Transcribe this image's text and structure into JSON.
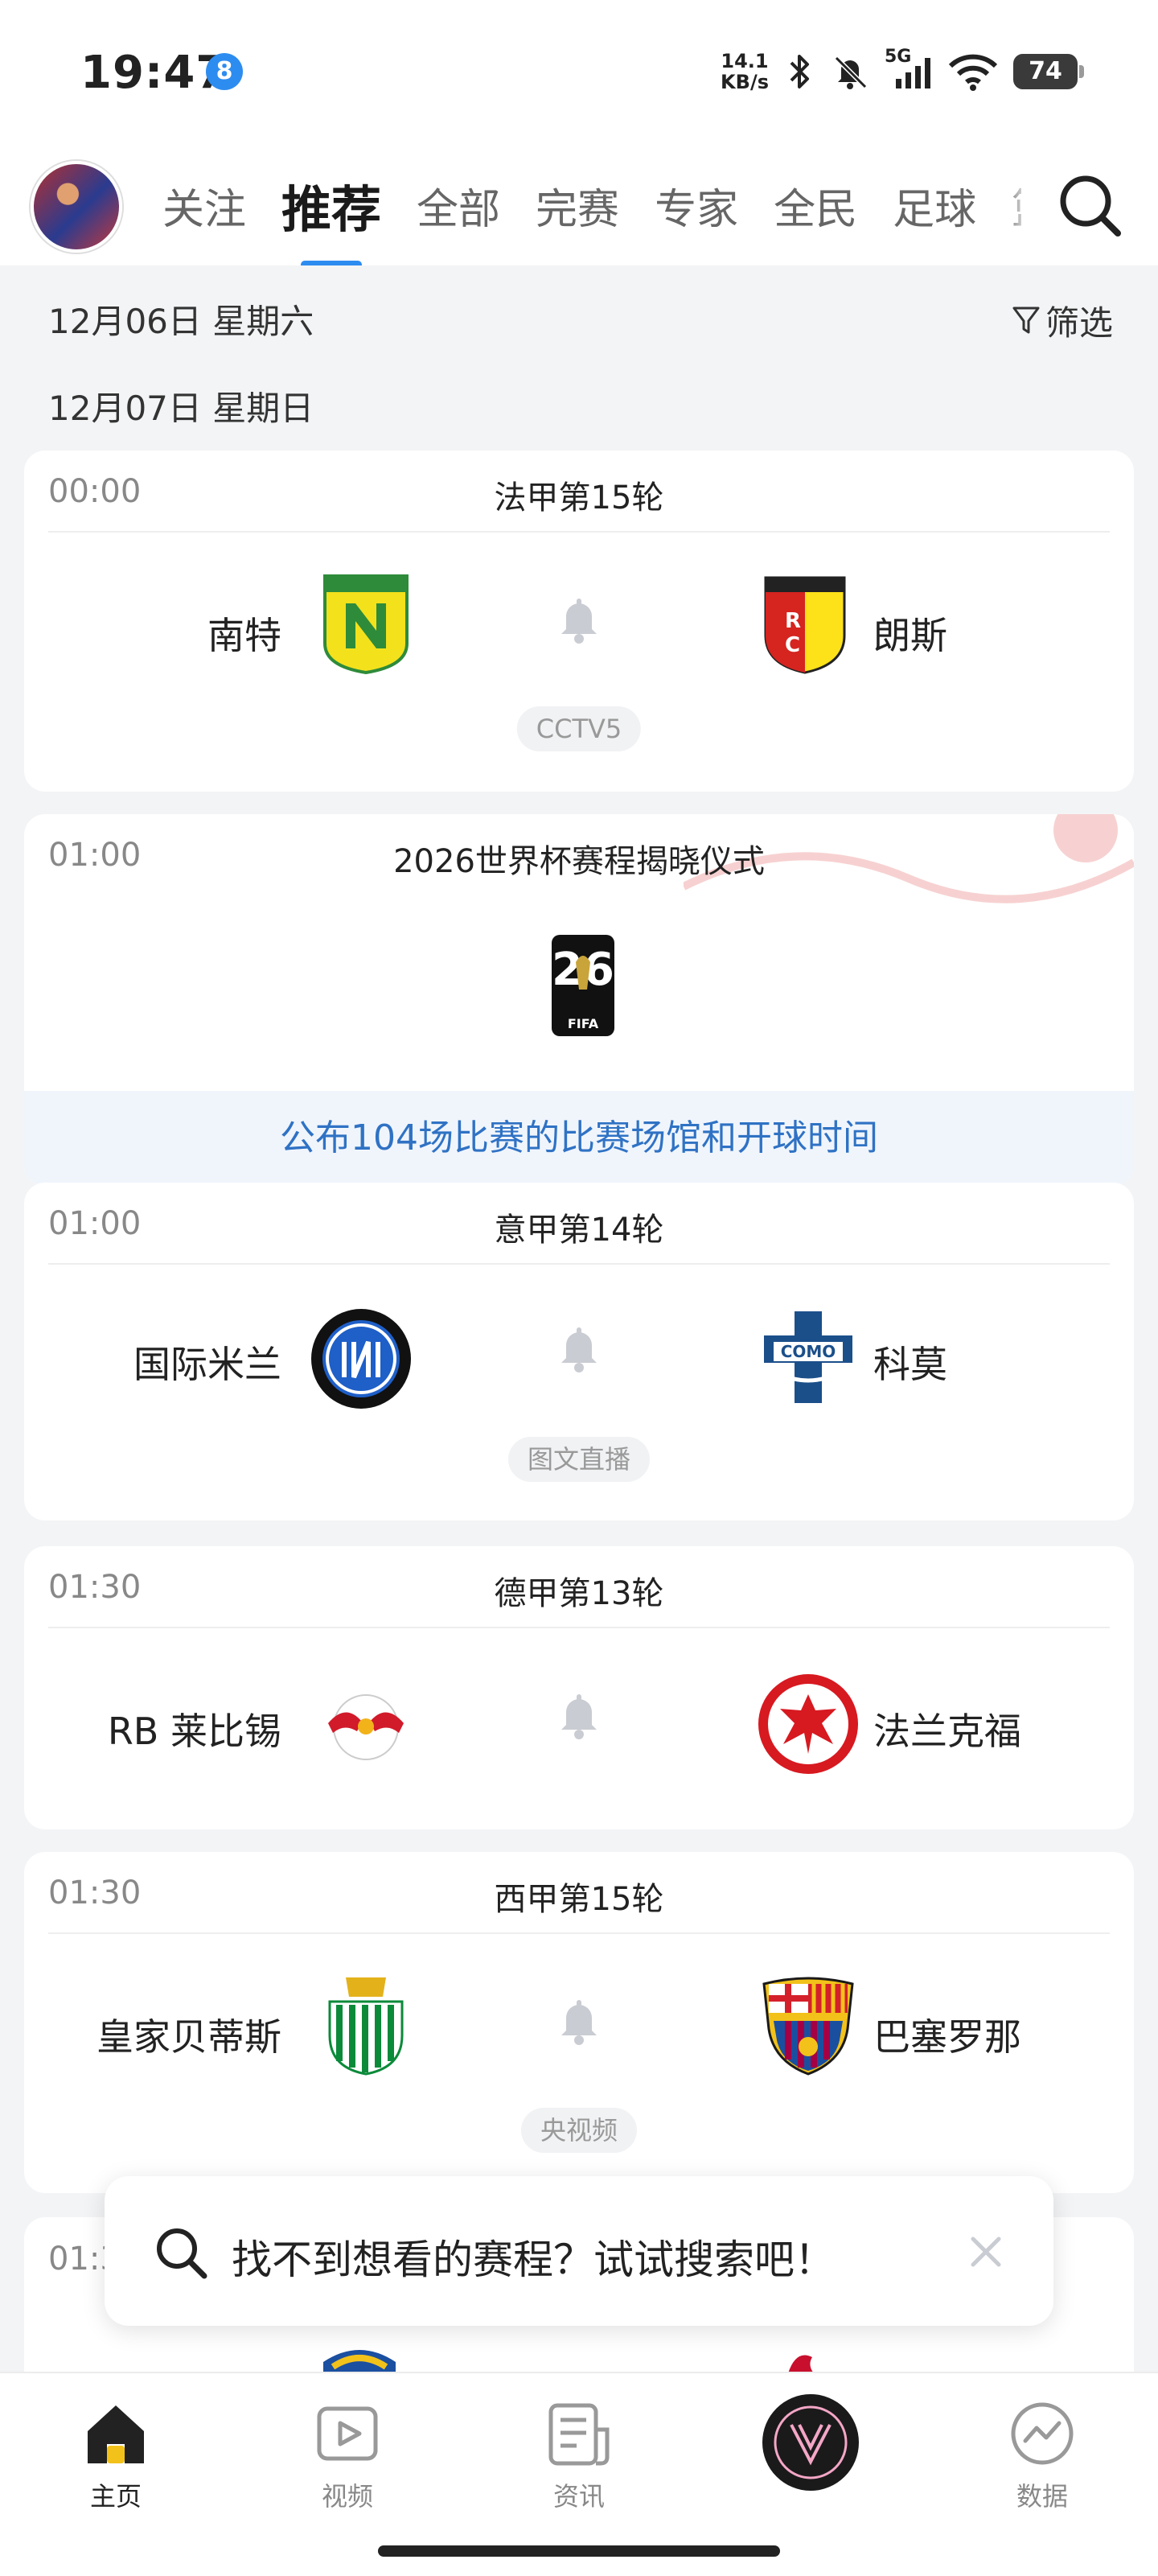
{
  "status_bar": {
    "time": "19:47",
    "notif_badge": "8",
    "net_speed_top": "14.1",
    "net_speed_bottom": "KB/s",
    "network": "5G",
    "battery": "74"
  },
  "top_nav": {
    "tabs": [
      "关注",
      "推荐",
      "全部",
      "完赛",
      "专家",
      "全民",
      "足球",
      "篮"
    ],
    "active_tab": "推荐"
  },
  "dates": {
    "first": "12月06日 星期六",
    "second": "12月07日 星期日"
  },
  "filter_label": "筛选",
  "matches": [
    {
      "time": "00:00",
      "league": "法甲第15轮",
      "home": "南特",
      "away": "朗斯",
      "tag": "CCTV5"
    },
    {
      "time": "01:00",
      "league": "意甲第14轮",
      "home": "国际米兰",
      "away": "科莫",
      "tag": "图文直播"
    },
    {
      "time": "01:30",
      "league": "德甲第13轮",
      "home": "RB 莱比锡",
      "away": "法兰克福",
      "tag": ""
    },
    {
      "time": "01:30",
      "league": "西甲第15轮",
      "home": "皇家贝蒂斯",
      "away": "巴塞罗那",
      "tag": "央视频"
    }
  ],
  "event": {
    "time": "01:00",
    "title": "2026世界杯赛程揭晓仪式",
    "banner": "公布104场比赛的比赛场馆和开球时间",
    "logo_text": "FIFA",
    "logo_number": "26"
  },
  "partial_match_time": "01:3",
  "search_prompt": "找不到想看的赛程？试试搜索吧！",
  "bottom_nav": {
    "items": [
      "主页",
      "视频",
      "资讯",
      "",
      "数据"
    ],
    "active": "主页"
  },
  "colors": {
    "accent": "#2d8cf0",
    "banner_text": "#2f72c4"
  },
  "icons": [
    "search-icon",
    "filter-icon",
    "bell-icon",
    "home-icon",
    "video-icon",
    "news-icon",
    "data-icon",
    "close-icon"
  ]
}
